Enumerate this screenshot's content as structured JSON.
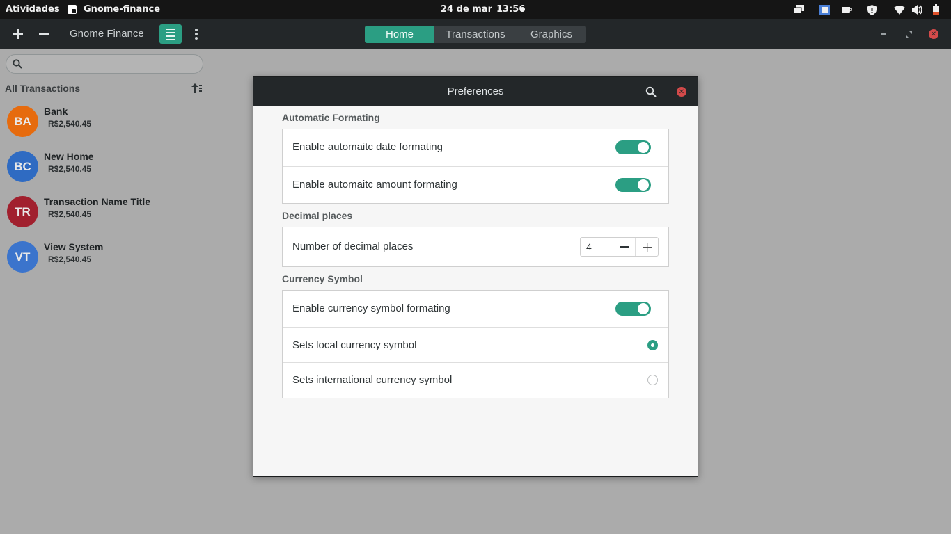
{
  "topbar": {
    "activities": "Atividades",
    "app_name": "Gnome-finance",
    "date": "24 de mar",
    "time": "13:56"
  },
  "headerbar": {
    "title": "Gnome Finance",
    "tabs": [
      {
        "label": "Home",
        "active": true
      },
      {
        "label": "Transactions",
        "active": false
      },
      {
        "label": "Graphics",
        "active": false
      }
    ]
  },
  "sidebar": {
    "search_placeholder": "",
    "heading": "All Transactions",
    "items": [
      {
        "initials": "BA",
        "name": "Bank",
        "amount": "R$2,540.45",
        "color": "#e66b0e"
      },
      {
        "initials": "BC",
        "name": "New Home",
        "amount": "R$2,540.45",
        "color": "#2f6bc2"
      },
      {
        "initials": "TR",
        "name": "Transaction Name Title",
        "amount": "R$2,540.45",
        "color": "#a1202e"
      },
      {
        "initials": "VT",
        "name": "View System",
        "amount": "R$2,540.45",
        "color": "#3b74cc"
      }
    ]
  },
  "dialog": {
    "title": "Preferences",
    "sections": {
      "auto": {
        "title": "Automatic Formating",
        "date_label": "Enable automaitc date formating",
        "date_on": true,
        "amount_label": "Enable automaitc amount formating",
        "amount_on": true
      },
      "decimal": {
        "title": "Decimal places",
        "label": "Number of decimal places",
        "value": "4"
      },
      "currency": {
        "title": "Currency Symbol",
        "enable_label": "Enable currency symbol formating",
        "enable_on": true,
        "local_label": "Sets local currency symbol",
        "local_selected": true,
        "intl_label": "Sets international currency symbol",
        "intl_selected": false
      }
    }
  },
  "colors": {
    "accent": "#2b9e83",
    "close": "#d34a4a",
    "headerbar": "#232729"
  },
  "icons": [
    "app-icon",
    "add-icon",
    "remove-icon",
    "menu-icon",
    "kebab-icon",
    "search-icon",
    "sort-icon",
    "close-icon",
    "minimize-icon",
    "maximize-icon",
    "wifi-icon",
    "volume-icon",
    "battery-icon",
    "shield-icon"
  ]
}
